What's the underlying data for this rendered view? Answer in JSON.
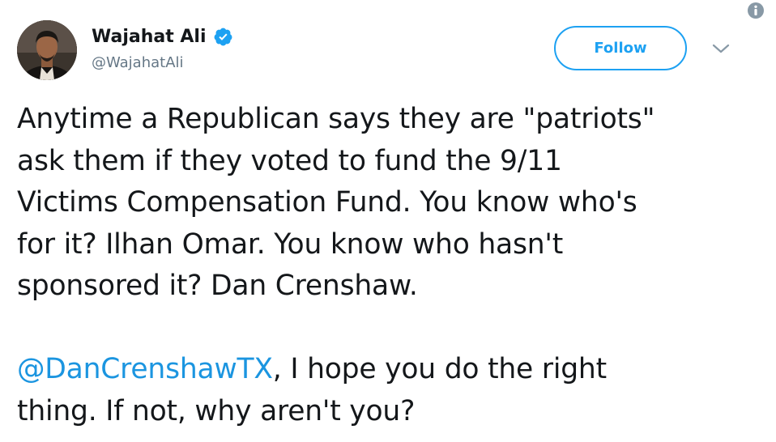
{
  "author": {
    "display_name": "Wajahat Ali",
    "handle": "@WajahatAli",
    "verified": true
  },
  "follow_button": {
    "label": "Follow"
  },
  "tweet": {
    "paragraph1": [
      "Anytime a Republican says they are \"patriots\"",
      "ask them if they voted to fund the 9/11",
      "Victims Compensation Fund. You know who's",
      "for it? Ilhan Omar. You know who hasn't",
      "sponsored it? Dan Crenshaw."
    ],
    "mention": "@DanCrenshawTX",
    "paragraph2_line1_rest": ", I hope you do the right",
    "paragraph2_line2": "thing. If not, why aren't you?"
  },
  "icons": {
    "info": "info-icon",
    "verified": "verified-badge-icon",
    "caret": "chevron-down-icon"
  },
  "colors": {
    "accent": "#1da1f2",
    "mention": "#1b95e0",
    "text": "#14171a",
    "secondary_text": "#657786",
    "info_icon": "#8899a6"
  }
}
